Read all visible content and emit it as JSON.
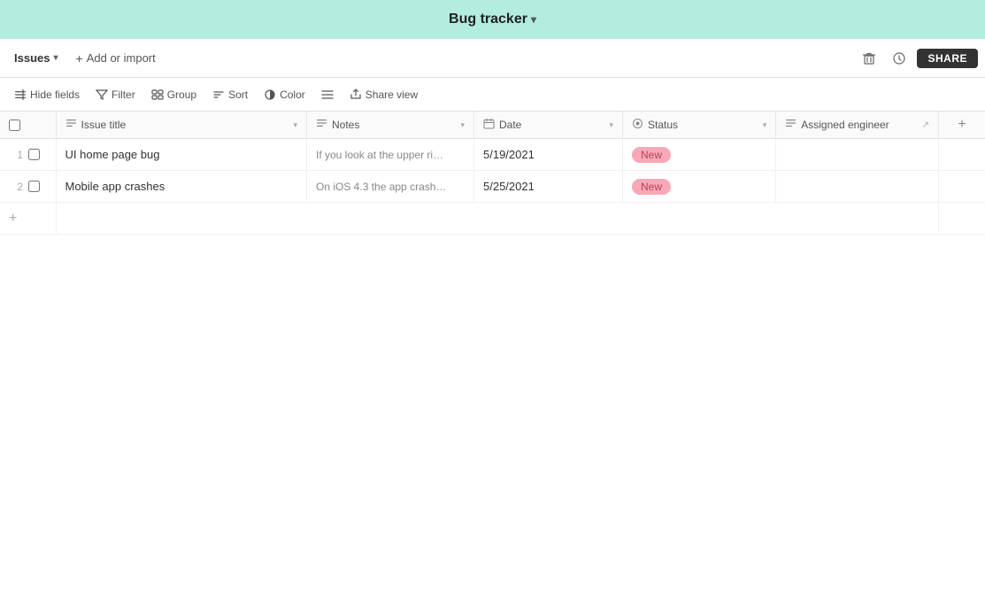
{
  "app": {
    "title": "Bug tracker",
    "caret": "▾"
  },
  "toolbar": {
    "issues_label": "Issues",
    "issues_caret": "▾",
    "add_import_label": "Add or import",
    "trash_icon": "🗑",
    "history_icon": "🕐",
    "share_label": "SHARE"
  },
  "view_toolbar": {
    "hide_fields_label": "Hide fields",
    "filter_label": "Filter",
    "group_label": "Group",
    "sort_label": "Sort",
    "color_label": "Color",
    "row_height_icon": "≡",
    "share_view_label": "Share view"
  },
  "table": {
    "columns": [
      {
        "id": "check",
        "label": "",
        "icon": ""
      },
      {
        "id": "issue_title",
        "label": "Issue title",
        "icon": "≡"
      },
      {
        "id": "notes",
        "label": "Notes",
        "icon": "≡"
      },
      {
        "id": "date",
        "label": "Date",
        "icon": "📅"
      },
      {
        "id": "status",
        "label": "Status",
        "icon": "◎"
      },
      {
        "id": "engineer",
        "label": "Assigned engineer",
        "icon": "≡"
      },
      {
        "id": "add",
        "label": "+",
        "icon": ""
      }
    ],
    "rows": [
      {
        "num": "1",
        "issue_title": "UI home page bug",
        "notes": "If you look at the upper ri…",
        "date": "5/19/2021",
        "status": "New",
        "engineer": ""
      },
      {
        "num": "2",
        "issue_title": "Mobile app crashes",
        "notes": "On iOS 4.3 the app crash…",
        "date": "5/25/2021",
        "status": "New",
        "engineer": ""
      }
    ],
    "add_row_label": "+"
  }
}
